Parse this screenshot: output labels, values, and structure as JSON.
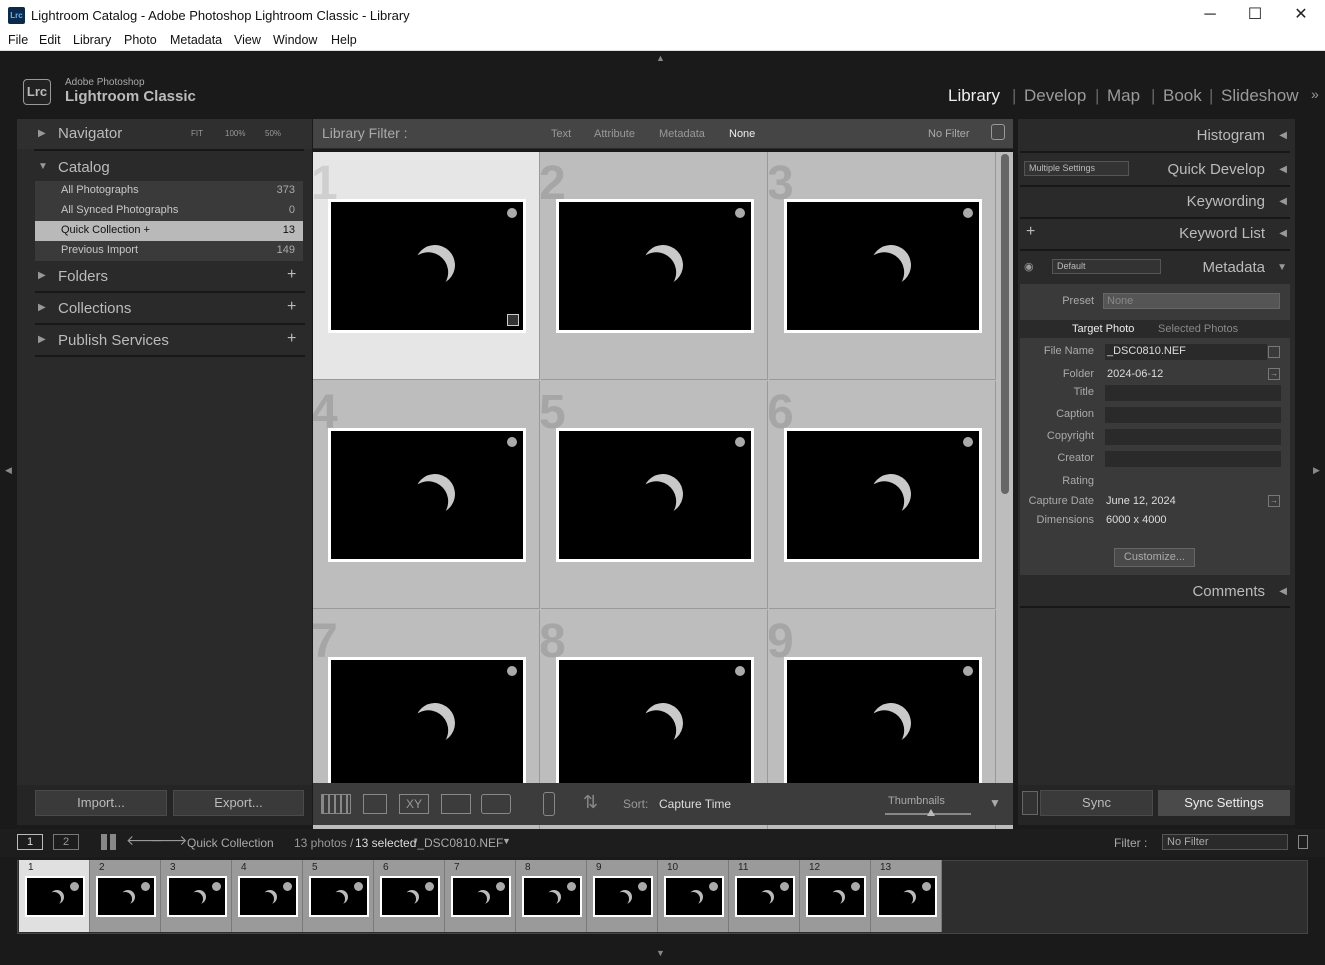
{
  "window": {
    "title": "Lightroom Catalog - Adobe Photoshop Lightroom Classic - Library",
    "app_icon": "Lrc",
    "minimize": "─",
    "maximize": "☐",
    "close": "✕"
  },
  "menu": [
    "File",
    "Edit",
    "Library",
    "Photo",
    "Metadata",
    "View",
    "Window",
    "Help"
  ],
  "identity": {
    "small": "Adobe Photoshop",
    "big": "Lightroom Classic",
    "logo": "Lrc"
  },
  "modules": [
    "Library",
    "Develop",
    "Map",
    "Book",
    "Slideshow"
  ],
  "left_panel": {
    "navigator": {
      "title": "Navigator",
      "fit": "FIT",
      "z1": "100%",
      "z2": "50%"
    },
    "catalog": {
      "title": "Catalog",
      "rows": [
        {
          "label": "All Photographs",
          "count": "373"
        },
        {
          "label": "All Synced Photographs",
          "count": "0"
        },
        {
          "label": "Quick Collection +",
          "count": "13"
        },
        {
          "label": "Previous Import",
          "count": "149"
        }
      ]
    },
    "folders": "Folders",
    "collections": "Collections",
    "publish": "Publish Services",
    "import_btn": "Import...",
    "export_btn": "Export..."
  },
  "filterbar": {
    "title": "Library Filter :",
    "text": "Text",
    "attribute": "Attribute",
    "metadata": "Metadata",
    "none": "None",
    "preset": "No Filter"
  },
  "grid": {
    "numbers": [
      "1",
      "2",
      "3",
      "4",
      "5",
      "6",
      "7",
      "8",
      "9"
    ]
  },
  "toolbar": {
    "sort_label": "Sort:",
    "sort_value": "Capture Time",
    "thumbnails": "Thumbnails"
  },
  "right_panel": {
    "histogram": "Histogram",
    "quick_develop": "Quick Develop",
    "qd_preset": "Multiple Settings",
    "keywording": "Keywording",
    "keyword_list": "Keyword List",
    "metadata": "Metadata",
    "md_preset": "Default",
    "preset_label": "Preset",
    "preset_value": "None",
    "tab_target": "Target Photo",
    "tab_selected": "Selected Photos",
    "fields": [
      {
        "label": "File Name",
        "value": "_DSC0810.NEF"
      },
      {
        "label": "Folder",
        "value": "2024-06-12"
      },
      {
        "label": "Title",
        "value": ""
      },
      {
        "label": "Caption",
        "value": ""
      },
      {
        "label": "Copyright",
        "value": ""
      },
      {
        "label": "Creator",
        "value": ""
      },
      {
        "label": "Rating",
        "value": ""
      },
      {
        "label": "Capture Date",
        "value": "June 12, 2024"
      },
      {
        "label": "Dimensions",
        "value": "6000 x 4000"
      }
    ],
    "customize": "Customize...",
    "comments": "Comments",
    "sync": "Sync",
    "sync_settings": "Sync Settings"
  },
  "filmstrip_bar": {
    "screen1": "1",
    "screen2": "2",
    "source": "Quick Collection",
    "count": "13 photos /",
    "selected": "13 selected",
    "file": "/_DSC0810.NEF",
    "filter_label": "Filter :",
    "filter_value": "No Filter"
  },
  "filmstrip": [
    "1",
    "2",
    "3",
    "4",
    "5",
    "6",
    "7",
    "8",
    "9",
    "10",
    "11",
    "12",
    "13"
  ]
}
